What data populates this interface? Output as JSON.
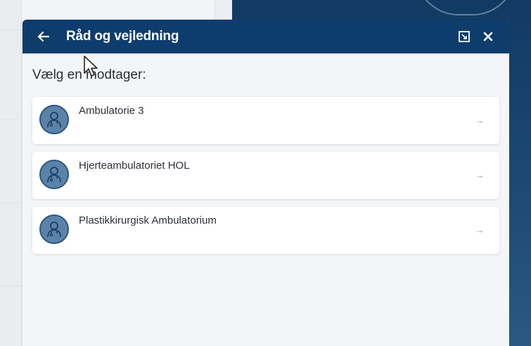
{
  "dialog": {
    "title": "Råd og vejledning",
    "back_icon": "arrow-left-icon",
    "expand_icon": "expand-icon",
    "close_icon": "close-icon"
  },
  "prompt": "Vælg en modtager:",
  "recipients": [
    {
      "label": "Ambulatorie 3",
      "icon": "doctor-icon",
      "arrow": "→"
    },
    {
      "label": "Hjerteambulatoriet HOL",
      "icon": "doctor-icon",
      "arrow": "→"
    },
    {
      "label": "Plastikkirurgisk Ambulatorium",
      "icon": "doctor-icon",
      "arrow": "→"
    }
  ],
  "colors": {
    "header": "#0e3d6d",
    "avatar": "#5b82a8",
    "panel": "#f4f5f7"
  }
}
